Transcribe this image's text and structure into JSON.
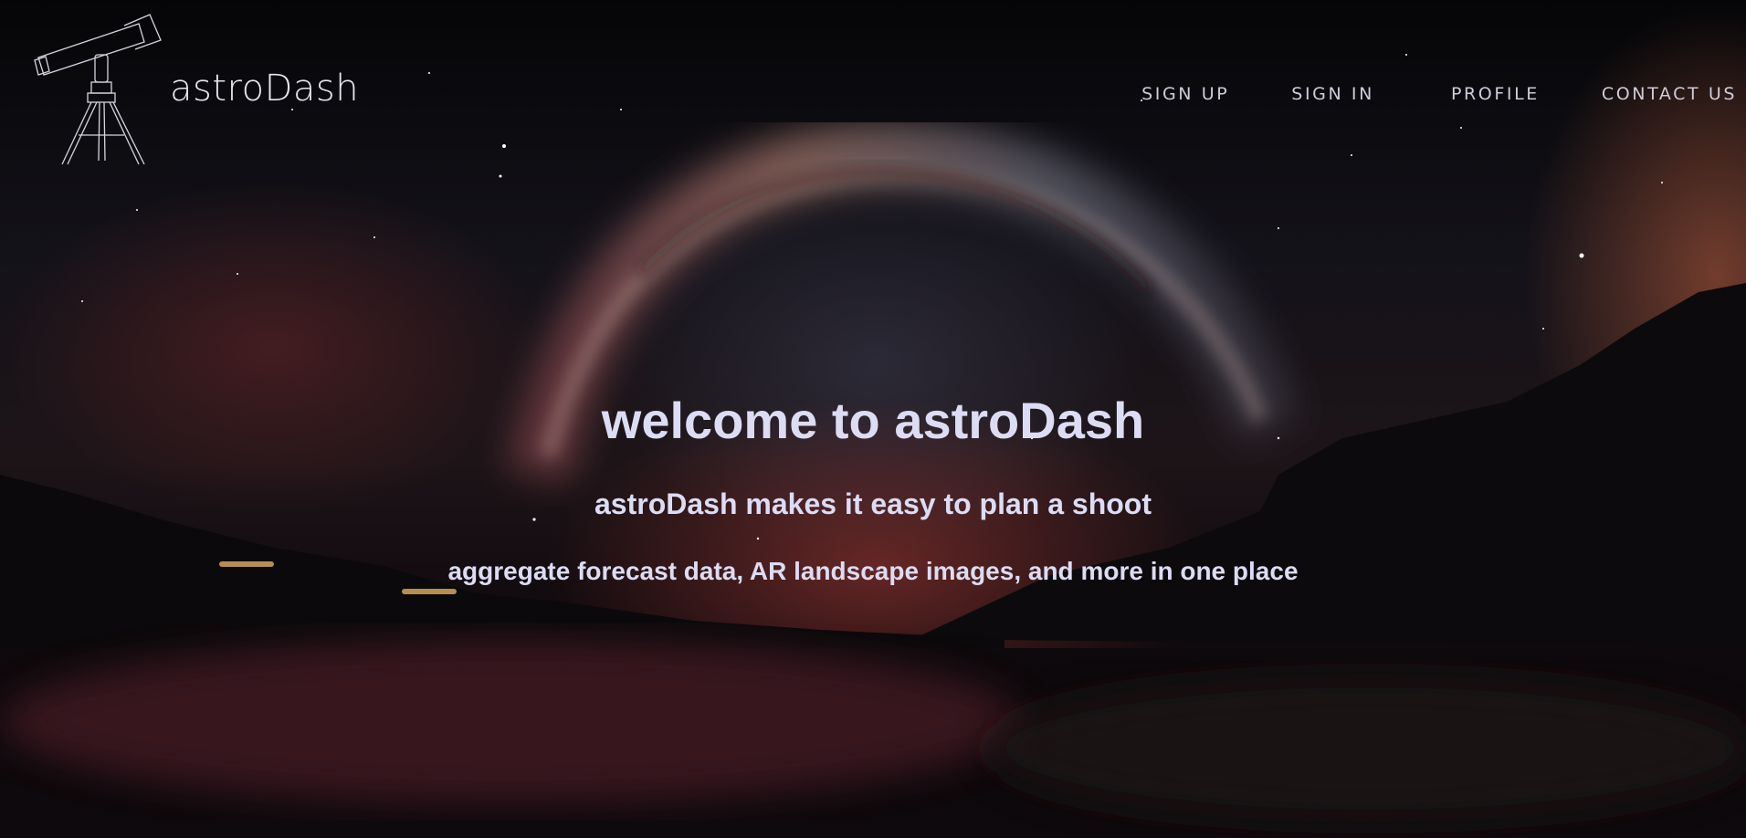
{
  "header": {
    "brand": "astroDash",
    "logo_icon": "telescope-icon",
    "nav": [
      {
        "label": "SIGN UP"
      },
      {
        "label": "SIGN IN"
      },
      {
        "label": "PROFILE"
      },
      {
        "label": "CONTACT US"
      }
    ]
  },
  "hero": {
    "title": "welcome to astroDash",
    "subtitle": "astroDash makes it easy to plan a shoot",
    "description": "aggregate forecast data, AR landscape images, and more in one place"
  },
  "colors": {
    "text_primary": "#dcdcf4",
    "nav_text": "#cfcbd8",
    "background": "#07060a"
  }
}
